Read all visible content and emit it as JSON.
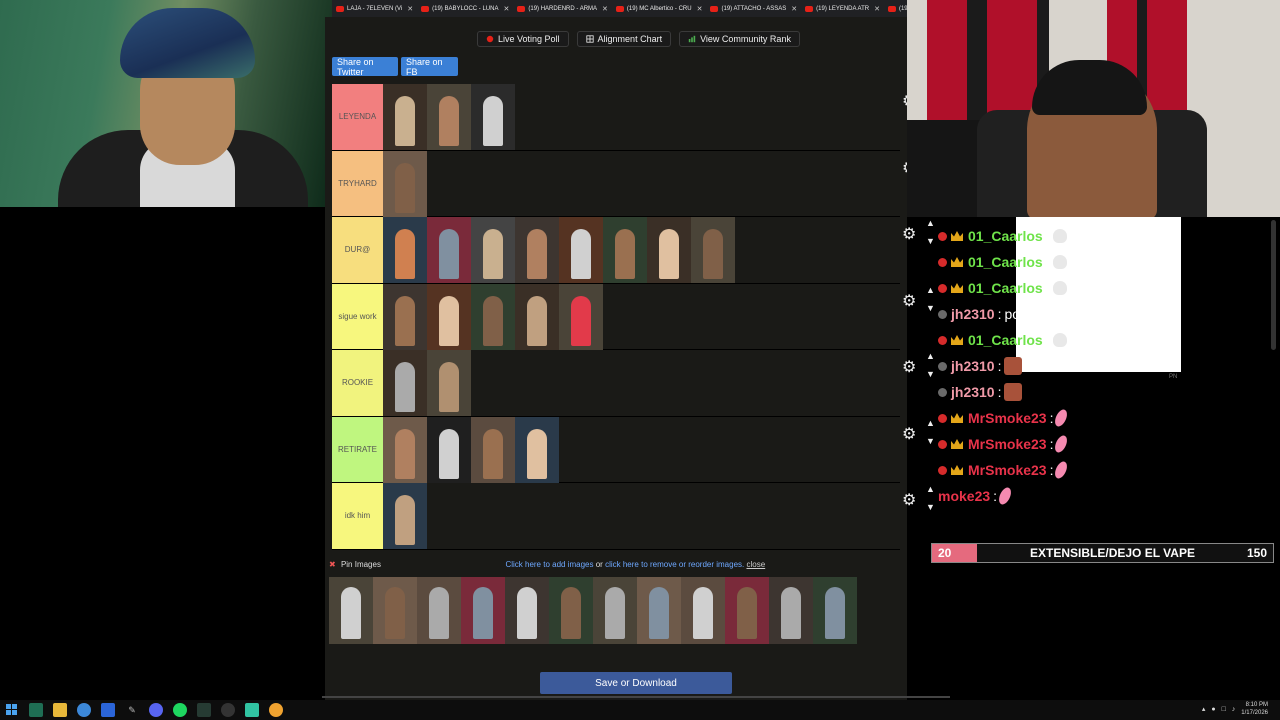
{
  "browser": {
    "tabs": [
      {
        "label": "LAJA - 7ELEVEN (Vi"
      },
      {
        "label": "(19) BABYLOCC - LUNA"
      },
      {
        "label": "(19) HARDENRD - ARMA"
      },
      {
        "label": "(19) MC Albertico - CRU"
      },
      {
        "label": "(19) ATTACHO - ASSAS"
      },
      {
        "label": "(19) LEYENDA ATR"
      },
      {
        "label": "(19"
      }
    ]
  },
  "tierlist": {
    "top_buttons": {
      "live_voting": "Live Voting Poll",
      "alignment_chart": "Alignment Chart",
      "community_rank": "View Community Rank"
    },
    "share_twitter": "Share on Twitter",
    "share_fb": "Share on FB",
    "tiers": [
      {
        "label": "LEYENDA",
        "color": "#f27f7f",
        "images": 3
      },
      {
        "label": "TRYHARD",
        "color": "#f5bf80",
        "images": 1
      },
      {
        "label": "DUR@",
        "color": "#f7de7e",
        "images": 8
      },
      {
        "label": "sigue work",
        "color": "#f7f77e",
        "images": 5
      },
      {
        "label": "ROOKIE",
        "color": "#f1f37e",
        "images": 2
      },
      {
        "label": "RETIRATE",
        "color": "#bff67f",
        "images": 4
      },
      {
        "label": "idk him",
        "color": "#f7f77e",
        "images": 1
      }
    ],
    "pin_images": "Pin Images",
    "add_images_link": "Click here to add images",
    "or_text": "or",
    "remove_link": "click here to remove or reorder images.",
    "close_link": "close",
    "pool_count": 12,
    "save_button": "Save or Download"
  },
  "chat": {
    "messages": [
      {
        "user": "01_Caarlos",
        "text": "",
        "user_color": "#6fe34a",
        "crown": true,
        "emote": "skull"
      },
      {
        "user": "01_Caarlos",
        "text": "",
        "user_color": "#6fe34a",
        "crown": true,
        "emote": "skull"
      },
      {
        "user": "01_Caarlos",
        "text": "",
        "user_color": "#6fe34a",
        "crown": true,
        "emote": "skull"
      },
      {
        "user": "jh2310",
        "text": "ponlo en mierda",
        "user_color": "#f09aa8",
        "crown": false,
        "emote": ""
      },
      {
        "user": "01_Caarlos",
        "text": "",
        "user_color": "#6fe34a",
        "crown": true,
        "emote": "skull"
      },
      {
        "user": "jh2310",
        "text": "",
        "user_color": "#f09aa8",
        "crown": false,
        "emote": "face"
      },
      {
        "user": "jh2310",
        "text": "",
        "user_color": "#f09aa8",
        "crown": false,
        "emote": "face"
      },
      {
        "user": "MrSmoke23",
        "text": "",
        "user_color": "#e8334a",
        "crown": true,
        "emote": "feather"
      },
      {
        "user": "MrSmoke23",
        "text": "",
        "user_color": "#e8334a",
        "crown": true,
        "emote": "feather"
      },
      {
        "user": "MrSmoke23",
        "text": "",
        "user_color": "#e8334a",
        "crown": true,
        "emote": "feather"
      },
      {
        "user": "moke23",
        "text": "",
        "user_color": "#e8334a",
        "crown": false,
        "emote": "feather"
      }
    ],
    "overlay_tag": "PN"
  },
  "goal": {
    "current": "20",
    "label": "EXTENSIBLE/DEJO EL VAPE",
    "target": "150",
    "progress": 0.133,
    "fill_color": "#e56a7e"
  },
  "taskbar": {
    "time": "8:10 PM",
    "date": "1/17/2026"
  }
}
